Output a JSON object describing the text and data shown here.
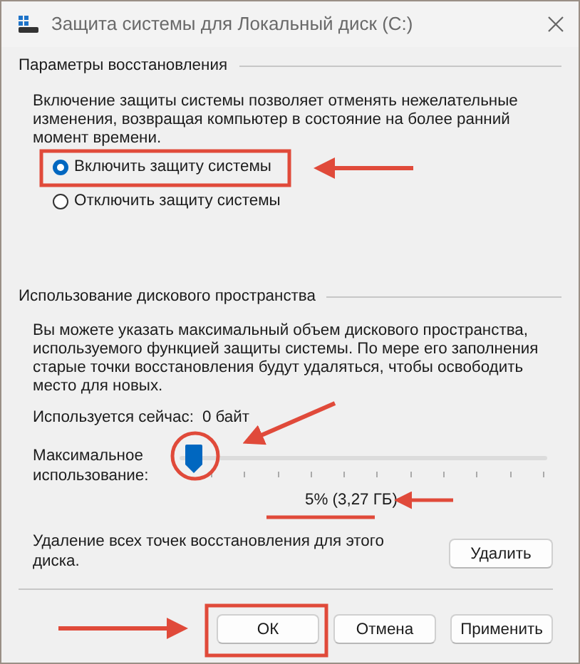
{
  "window": {
    "title": "Защита системы для Локальный диск (C:)"
  },
  "restore_settings": {
    "heading": "Параметры восстановления",
    "description": "Включение защиты системы позволяет отменять нежелательные изменения, возвращая компьютер в состояние на более ранний момент времени.",
    "options": [
      {
        "label": "Включить защиту системы",
        "selected": true
      },
      {
        "label": "Отключить защиту системы",
        "selected": false
      }
    ]
  },
  "disk_usage": {
    "heading": "Использование дискового пространства",
    "description": "Вы можете указать максимальный объем дискового пространства, используемого функцией защиты системы. По мере его заполнения старые точки восстановления будут удаляться, чтобы освободить место для новых.",
    "current_usage": {
      "label": "Используется сейчас:",
      "value": "0 байт"
    },
    "max_usage": {
      "label": "Максимальное использование:",
      "level": 0.04,
      "reading": "5% (3,27 ГБ)"
    },
    "delete": {
      "text": "Удаление всех точек восстановления для этого диска.",
      "button": "Удалить"
    }
  },
  "buttons": [
    {
      "label": "ОК"
    },
    {
      "label": "Отмена"
    },
    {
      "label": "Применить"
    }
  ]
}
